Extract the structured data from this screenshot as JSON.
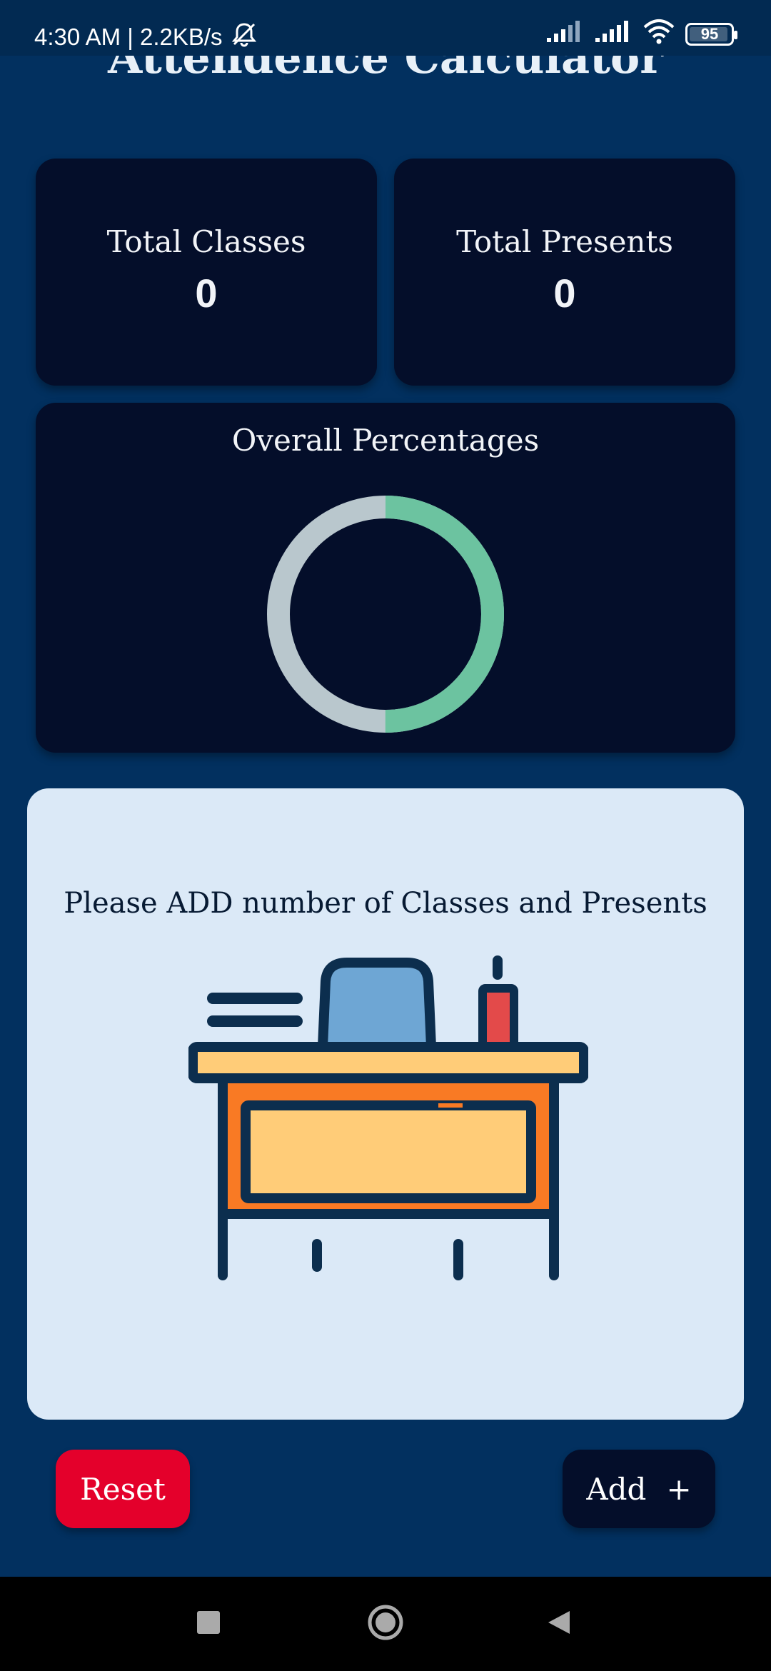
{
  "status_bar": {
    "time_speed": "4:30 AM | 2.2KB/s",
    "battery": "95",
    "battery_level": 0.95
  },
  "app": {
    "title": "Attendence Calculator"
  },
  "stats": {
    "total_classes_label": "Total Classes",
    "total_classes_value": "0",
    "total_presents_label": "Total Presents",
    "total_presents_value": "0"
  },
  "overall": {
    "title": "Overall Percentages",
    "ring_present_fraction": 0.5,
    "ring_present_color": "#6cc3a0",
    "ring_absent_color": "#b9c7cd"
  },
  "empty_state": {
    "message": "Please ADD number of Classes and Presents",
    "illustration": "desk-illustration-icon"
  },
  "actions": {
    "reset_label": "Reset",
    "add_label": "Add",
    "add_icon": "+"
  },
  "colors": {
    "background": "#02305f",
    "card": "#040e2a",
    "illustration_card": "#dbe9f7",
    "reset": "#e4002b"
  }
}
